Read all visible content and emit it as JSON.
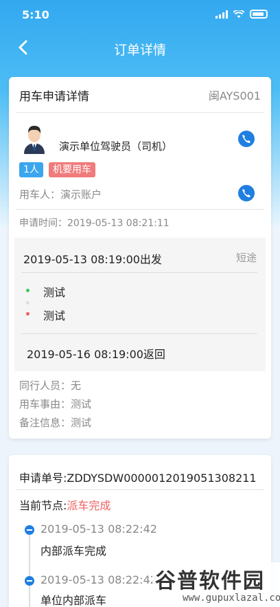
{
  "status": {
    "time": "5:10"
  },
  "nav": {
    "title": "订单详情"
  },
  "card1": {
    "title": "用车申请详情",
    "order_code": "闽AYS001",
    "driver_name": "演示单位驾驶员（司机）",
    "tag_count": "1人",
    "tag_type": "机要用车",
    "user_line": "用车人：演示账户",
    "apply_time": "申请时间：2019-05-13 08:21:11",
    "trip": {
      "depart": "2019-05-13 08:19:00出发",
      "kind": "短途",
      "stop1": "测试",
      "stop2": "测试",
      "return": "2019-05-16 08:19:00返回"
    },
    "companions": "同行人员：无",
    "reason": "用车事由：测试",
    "remark": "备注信息：测试"
  },
  "card2": {
    "order_no": "申请单号:ZDDYSDW0000012019051308211",
    "node_label": "当前节点:",
    "node_value": "派车完成",
    "timeline": [
      {
        "time": "2019-05-13 08:22:42",
        "desc": "内部派车完成"
      },
      {
        "time": "2019-05-13 08:22:42",
        "desc": "单位内部派车"
      }
    ]
  },
  "watermark": {
    "main": "谷普软件园",
    "sub": "www.gupuxlazal.com"
  },
  "colors": {
    "accent": "#1f7fe0",
    "header": "#33a8f0",
    "red": "#f06060"
  }
}
